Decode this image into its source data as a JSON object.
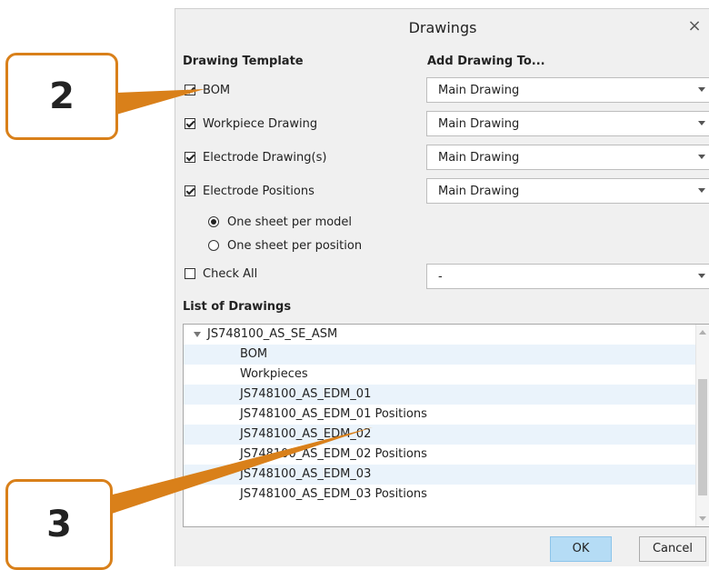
{
  "dialog": {
    "title": "Drawings",
    "close_symbol": "×",
    "headings": {
      "template": "Drawing Template",
      "add_to": "Add Drawing To...",
      "list": "List of Drawings"
    },
    "templates": [
      {
        "label": "BOM",
        "checked": true,
        "target": "Main Drawing"
      },
      {
        "label": "Workpiece Drawing",
        "checked": true,
        "target": "Main Drawing"
      },
      {
        "label": "Electrode Drawing(s)",
        "checked": true,
        "target": "Main Drawing"
      },
      {
        "label": "Electrode Positions",
        "checked": true,
        "target": "Main Drawing"
      }
    ],
    "sheet_options": [
      {
        "label": "One sheet per model",
        "selected": true
      },
      {
        "label": "One sheet per position",
        "selected": false
      }
    ],
    "check_all": {
      "label": "Check All",
      "checked": false,
      "target": "-"
    },
    "list": {
      "root": "JS748100_AS_SE_ASM",
      "items": [
        "BOM",
        "Workpieces",
        "JS748100_AS_EDM_01",
        "JS748100_AS_EDM_01 Positions",
        "JS748100_AS_EDM_02",
        "JS748100_AS_EDM_02 Positions",
        "JS748100_AS_EDM_03",
        "JS748100_AS_EDM_03 Positions"
      ]
    },
    "buttons": {
      "ok": "OK",
      "cancel": "Cancel"
    }
  },
  "callouts": {
    "first": "2",
    "second": "3"
  },
  "colors": {
    "accent": "#d9801a",
    "ok_button": "#b5dcf5",
    "row_highlight": "#eaf3fb"
  }
}
